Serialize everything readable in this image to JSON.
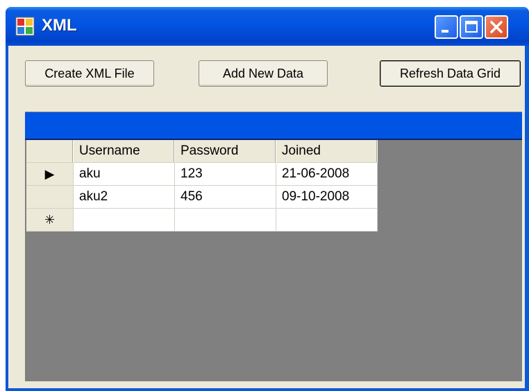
{
  "window": {
    "title": "XML",
    "colors": {
      "titlebar": "#0454E2",
      "client": "#ECE9D8",
      "grid_bg": "#808080",
      "grid_caption": "#0054E3"
    },
    "icons": {
      "app": "app-window-icon",
      "minimize": "minimize-icon",
      "maximize": "maximize-icon",
      "close": "close-icon"
    }
  },
  "toolbar": {
    "create_label": "Create XML File",
    "add_label": "Add New Data",
    "refresh_label": "Refresh Data Grid"
  },
  "grid": {
    "columns": [
      "Username",
      "Password",
      "Joined"
    ],
    "rows": [
      {
        "indicator": "▶",
        "username": "aku",
        "password": "123",
        "joined": "21-06-2008"
      },
      {
        "indicator": "",
        "username": "aku2",
        "password": "456",
        "joined": "09-10-2008"
      },
      {
        "indicator": "✳",
        "username": "",
        "password": "",
        "joined": ""
      }
    ]
  }
}
